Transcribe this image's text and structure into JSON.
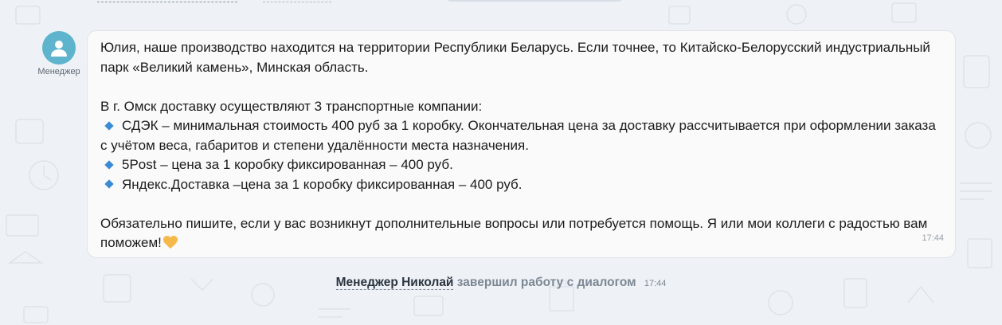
{
  "colors": {
    "background": "#eef2f6",
    "bubble": "#fafafa",
    "avatar": "#5db4cc",
    "bullet": "#3a8ad6",
    "heart": "#f5b94a",
    "muted": "#7d8793"
  },
  "message": {
    "sender_label": "Менеджер",
    "avatar_icon": "user-silhouette-icon",
    "paragraph1": "Юлия, наше производство находится на территории Республики Беларусь. Если точнее, то Китайско-Белорусский индустриальный парк «Великий камень», Минская область.",
    "intro": "В г. Омск доставку осуществляют 3 транспортные компании:",
    "bullets": [
      "СДЭК – минимальная стоимость 400 руб за 1 коробку. Окончательная цена за доставку рассчитывается при оформлении заказа с учётом веса, габаритов и степени удалённости места назначения.",
      "5Post – цена за 1 коробку фиксированная – 400 руб.",
      "Яндекс.Доставка –цена за 1 коробку фиксированная – 400 руб."
    ],
    "closing": "Обязательно пишите, если у вас возникнут дополнительные вопросы или потребуется помощь. Я или мои коллеги с радостью вам поможем!",
    "emoji": "yellow-heart-icon",
    "time": "17:44"
  },
  "system": {
    "actor": "Менеджер Николай",
    "action": "завершил работу с диалогом",
    "time": "17:44"
  }
}
